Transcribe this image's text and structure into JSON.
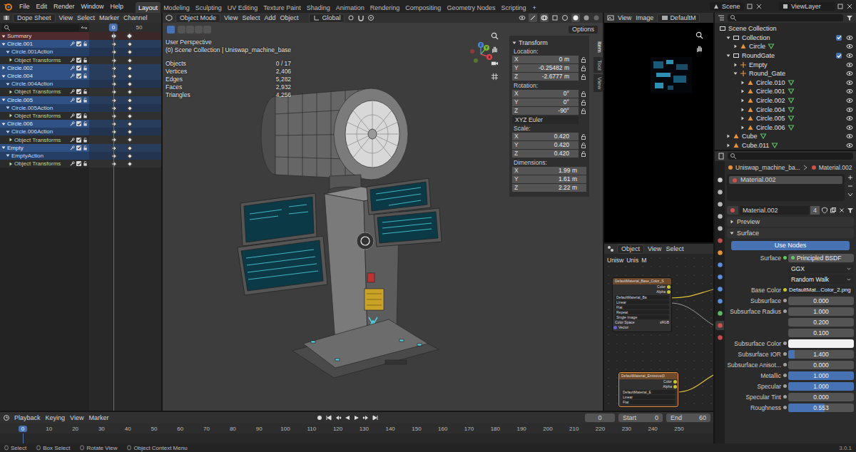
{
  "topbar": {
    "menus": [
      "File",
      "Edit",
      "Render",
      "Window",
      "Help"
    ],
    "workspaces": [
      {
        "label": "Layout",
        "selected": true
      },
      {
        "label": "Modeling",
        "selected": false
      },
      {
        "label": "Sculpting",
        "selected": false
      },
      {
        "label": "UV Editing",
        "selected": false
      },
      {
        "label": "Texture Paint",
        "selected": false
      },
      {
        "label": "Shading",
        "selected": false
      },
      {
        "label": "Animation",
        "selected": false
      },
      {
        "label": "Rendering",
        "selected": false
      },
      {
        "label": "Compositing",
        "selected": false
      },
      {
        "label": "Geometry Nodes",
        "selected": false
      },
      {
        "label": "Scripting",
        "selected": false
      }
    ],
    "add": "+",
    "scene": "Scene",
    "view_layer": "ViewLayer"
  },
  "dopesheet": {
    "mode": "Dope Sheet",
    "menus": [
      "View",
      "Select",
      "Marker",
      "Channel"
    ],
    "current_frame": "0",
    "ruler": [
      {
        "frame": 50,
        "label": "50"
      }
    ],
    "channels": [
      {
        "label": "Summary",
        "kind": "summary",
        "expanded": true,
        "keys": [
          0,
          30
        ]
      },
      {
        "label": "Circle.001",
        "kind": "object",
        "expanded": true,
        "enabled": true,
        "keys": [
          0,
          30
        ]
      },
      {
        "label": "Circle.001Action",
        "kind": "action",
        "expanded": true,
        "keys": [
          0,
          30
        ]
      },
      {
        "label": "Object Transforms",
        "kind": "group",
        "expanded": false,
        "enabled": true,
        "keys": [
          0,
          30
        ]
      },
      {
        "label": "Circle.002",
        "kind": "object",
        "expanded": false,
        "enabled": true,
        "keys": [
          0,
          30
        ]
      },
      {
        "label": "Circle.004",
        "kind": "object",
        "expanded": true,
        "enabled": true,
        "keys": [
          0,
          30
        ]
      },
      {
        "label": "Circle.004Action",
        "kind": "action",
        "expanded": true,
        "keys": [
          0,
          30
        ]
      },
      {
        "label": "Object Transforms",
        "kind": "group",
        "expanded": false,
        "enabled": true,
        "keys": [
          0,
          30
        ]
      },
      {
        "label": "Circle.005",
        "kind": "object",
        "expanded": true,
        "enabled": true,
        "keys": [
          0,
          30
        ]
      },
      {
        "label": "Circle.005Action",
        "kind": "action",
        "expanded": true,
        "keys": [
          0,
          30
        ]
      },
      {
        "label": "Object Transforms",
        "kind": "group",
        "expanded": false,
        "enabled": true,
        "keys": [
          0,
          30
        ]
      },
      {
        "label": "Circle.006",
        "kind": "object",
        "expanded": true,
        "enabled": true,
        "keys": [
          0,
          30
        ]
      },
      {
        "label": "Circle.006Action",
        "kind": "action",
        "expanded": true,
        "keys": [
          0,
          30
        ]
      },
      {
        "label": "Object Transforms",
        "kind": "group",
        "expanded": false,
        "enabled": true,
        "keys": [
          0,
          30
        ]
      },
      {
        "label": "Empty",
        "kind": "object",
        "expanded": true,
        "enabled": true,
        "keys": [
          0,
          30
        ]
      },
      {
        "label": "EmptyAction",
        "kind": "action",
        "expanded": true,
        "keys": [
          0,
          30
        ]
      },
      {
        "label": "Object Transforms",
        "kind": "group",
        "expanded": false,
        "enabled": true,
        "keys": [
          0,
          30
        ]
      }
    ]
  },
  "viewport": {
    "mode": "Object Mode",
    "menus": [
      "View",
      "Select",
      "Add",
      "Object"
    ],
    "orientation": "Global",
    "options": "Options",
    "view_name": "User Perspective",
    "context": "(0) Scene Collection | Uniswap_machine_base",
    "stats": [
      {
        "label": "Objects",
        "value": "0 / 17"
      },
      {
        "label": "Vertices",
        "value": "2,406"
      },
      {
        "label": "Edges",
        "value": "5,282"
      },
      {
        "label": "Faces",
        "value": "2,932"
      },
      {
        "label": "Triangles",
        "value": "4,256"
      }
    ],
    "gizmo": [
      "X",
      "Y",
      "Z"
    ],
    "side_tabs": [
      {
        "label": "Item",
        "selected": true
      },
      {
        "label": "Tool",
        "selected": false
      },
      {
        "label": "View",
        "selected": false
      }
    ],
    "transform": {
      "title": "Transform",
      "groups": [
        {
          "label": "Location:",
          "lockable": true,
          "fields": [
            {
              "axis": "X",
              "value": "0 m"
            },
            {
              "axis": "Y",
              "value": "-0.25482 m"
            },
            {
              "axis": "Z",
              "value": "-2.6777 m"
            }
          ]
        },
        {
          "label": "Rotation:",
          "lockable": true,
          "fields": [
            {
              "axis": "X",
              "value": "0°"
            },
            {
              "axis": "Y",
              "value": "0°"
            },
            {
              "axis": "Z",
              "value": "-90°"
            }
          ],
          "mode": "XYZ Euler"
        },
        {
          "label": "Scale:",
          "lockable": true,
          "fields": [
            {
              "axis": "X",
              "value": "0.420"
            },
            {
              "axis": "Y",
              "value": "0.420"
            },
            {
              "axis": "Z",
              "value": "0.420"
            }
          ]
        },
        {
          "label": "Dimensions:",
          "lockable": false,
          "fields": [
            {
              "axis": "X",
              "value": "1.99 m"
            },
            {
              "axis": "Y",
              "value": "1.61 m"
            },
            {
              "axis": "Z",
              "value": "2.22 m"
            }
          ]
        }
      ]
    }
  },
  "image_editor": {
    "menus": [
      "View",
      "Image"
    ],
    "image": "DefaultM"
  },
  "node_editor": {
    "mode": "Object",
    "menus": [
      "View",
      "Select"
    ],
    "path": [
      "Unisw",
      "Unis",
      "M"
    ],
    "nodes": [
      {
        "title": "DefaultMaterial_Base_Color_S",
        "outputs": [
          "Color",
          "Alpha"
        ],
        "image": "DefaultMaterial_Ba",
        "options": [
          "Linear",
          "Flat",
          "Repeat",
          "Single Image"
        ],
        "color_space": "sRGB",
        "color_space_label": "Color Space",
        "input": "Vector"
      },
      {
        "title": "DefaultMaterial_Emissive(0",
        "outputs": [
          "Color",
          "Alpha"
        ],
        "image": "DefaultMaterial_E",
        "options": [
          "Linear",
          "Flat"
        ]
      }
    ]
  },
  "outliner": {
    "items": [
      {
        "name": "Scene Collection",
        "kind": "scene",
        "depth": 0,
        "expanded": true
      },
      {
        "name": "Collection",
        "kind": "collection",
        "depth": 1,
        "expanded": true,
        "checked": true,
        "visible": true
      },
      {
        "name": "Circle",
        "kind": "object",
        "depth": 2,
        "expanded": false,
        "visible": true
      },
      {
        "name": "RoundGate",
        "kind": "collection",
        "depth": 1,
        "expanded": true,
        "checked": true,
        "visible": true
      },
      {
        "name": "Empty",
        "kind": "empty",
        "depth": 2,
        "expanded": false,
        "visible": true
      },
      {
        "name": "Round_Gate",
        "kind": "empty",
        "depth": 2,
        "expanded": true,
        "visible": true
      },
      {
        "name": "Circle.010",
        "kind": "object",
        "depth": 3,
        "expanded": false,
        "visible": true
      },
      {
        "name": "Circle.001",
        "kind": "object",
        "depth": 3,
        "expanded": false,
        "visible": true
      },
      {
        "name": "Circle.002",
        "kind": "object",
        "depth": 3,
        "expanded": false,
        "visible": true
      },
      {
        "name": "Circle.004",
        "kind": "object",
        "depth": 3,
        "expanded": false,
        "visible": true
      },
      {
        "name": "Circle.005",
        "kind": "object",
        "depth": 3,
        "expanded": false,
        "visible": true
      },
      {
        "name": "Circle.006",
        "kind": "object",
        "depth": 3,
        "expanded": false,
        "visible": true
      },
      {
        "name": "Cube",
        "kind": "mesh",
        "depth": 1,
        "expanded": false,
        "visible": true
      },
      {
        "name": "Cube.011",
        "kind": "mesh",
        "depth": 1,
        "expanded": false,
        "visible": true
      }
    ]
  },
  "properties": {
    "tabs": [
      {
        "selected": false,
        "color": "#cfcfcf"
      },
      {
        "selected": false,
        "color": "#b8b8b8"
      },
      {
        "selected": false,
        "color": "#b8b8b8"
      },
      {
        "selected": false,
        "color": "#b8b8b8"
      },
      {
        "selected": false,
        "color": "#b8b8b8"
      },
      {
        "selected": false,
        "color": "#c0504d"
      },
      {
        "selected": false,
        "color": "#e8913a"
      },
      {
        "selected": false,
        "color": "#5a8ee0"
      },
      {
        "selected": false,
        "color": "#5a8ee0"
      },
      {
        "selected": false,
        "color": "#5a8ee0"
      },
      {
        "selected": false,
        "color": "#5a8ee0"
      },
      {
        "selected": false,
        "color": "#5dbb63"
      },
      {
        "selected": true,
        "color": "#d0504a"
      },
      {
        "selected": false,
        "color": "#c94a4a"
      }
    ],
    "path": [
      "Uniswap_machine_ba...",
      "Material.002"
    ],
    "slots": [
      {
        "name": "Material.002",
        "selected": true
      }
    ],
    "material": "Material.002",
    "users": "4",
    "panels": [
      {
        "label": "Preview",
        "expanded": false
      },
      {
        "label": "Surface",
        "expanded": true
      }
    ],
    "use_nodes": {
      "label": "Use Nodes",
      "on": true
    },
    "rows": [
      {
        "label": "Surface",
        "kind": "shader",
        "value": "Principled BSDF"
      },
      {
        "label": "",
        "kind": "dropdown",
        "value": "GGX"
      },
      {
        "label": "",
        "kind": "dropdown",
        "value": "Random Walk"
      },
      {
        "label": "Base Color",
        "kind": "link",
        "value": "DefaultMat...Color_2.png"
      },
      {
        "label": "Subsurface",
        "kind": "slider",
        "value": "0.000",
        "level": 0
      },
      {
        "label": "Subsurface Radius",
        "kind": "vector",
        "values": [
          "1.000",
          "0.200",
          "0.100"
        ]
      },
      {
        "label": "Subsurface Color",
        "kind": "color",
        "color": "#f2f2f2"
      },
      {
        "label": "Subsurface IOR",
        "kind": "slider",
        "value": "1.400",
        "level": 0.1
      },
      {
        "label": "Subsurface Anisot...",
        "kind": "slider",
        "value": "0.000",
        "level": 0
      },
      {
        "label": "Metallic",
        "kind": "slider",
        "value": "1.000",
        "level": 1
      },
      {
        "label": "Specular",
        "kind": "slider",
        "value": "1.000",
        "level": 1
      },
      {
        "label": "Specular Tint",
        "kind": "slider",
        "value": "0.000",
        "level": 0
      },
      {
        "label": "Roughness",
        "kind": "slider",
        "value": "0.553",
        "level": 0.553
      }
    ]
  },
  "timeline": {
    "menus": [
      "Playback",
      "Keying",
      "View",
      "Marker"
    ],
    "frame": "0",
    "start_label": "Start",
    "start": "0",
    "end_label": "End",
    "end": "60",
    "ruler": [
      {
        "label": "0",
        "selected": true
      },
      {
        "label": "10",
        "selected": false
      },
      {
        "label": "20",
        "selected": false
      },
      {
        "label": "30",
        "selected": false
      },
      {
        "label": "40",
        "selected": false
      },
      {
        "label": "50",
        "selected": false
      },
      {
        "label": "60",
        "selected": false
      },
      {
        "label": "70",
        "selected": false
      },
      {
        "label": "80",
        "selected": false
      },
      {
        "label": "90",
        "selected": false
      },
      {
        "label": "100",
        "selected": false
      },
      {
        "label": "110",
        "selected": false
      },
      {
        "label": "120",
        "selected": false
      },
      {
        "label": "130",
        "selected": false
      },
      {
        "label": "140",
        "selected": false
      },
      {
        "label": "150",
        "selected": false
      },
      {
        "label": "160",
        "selected": false
      },
      {
        "label": "170",
        "selected": false
      },
      {
        "label": "180",
        "selected": false
      },
      {
        "label": "190",
        "selected": false
      },
      {
        "label": "200",
        "selected": false
      },
      {
        "label": "210",
        "selected": false
      },
      {
        "label": "220",
        "selected": false
      },
      {
        "label": "230",
        "selected": false
      },
      {
        "label": "240",
        "selected": false
      },
      {
        "label": "250",
        "selected": false
      }
    ]
  },
  "statusbar": {
    "hints": [
      "Select",
      "Box Select",
      "Rotate View",
      "Object Context Menu"
    ],
    "version": "3.0.1"
  }
}
